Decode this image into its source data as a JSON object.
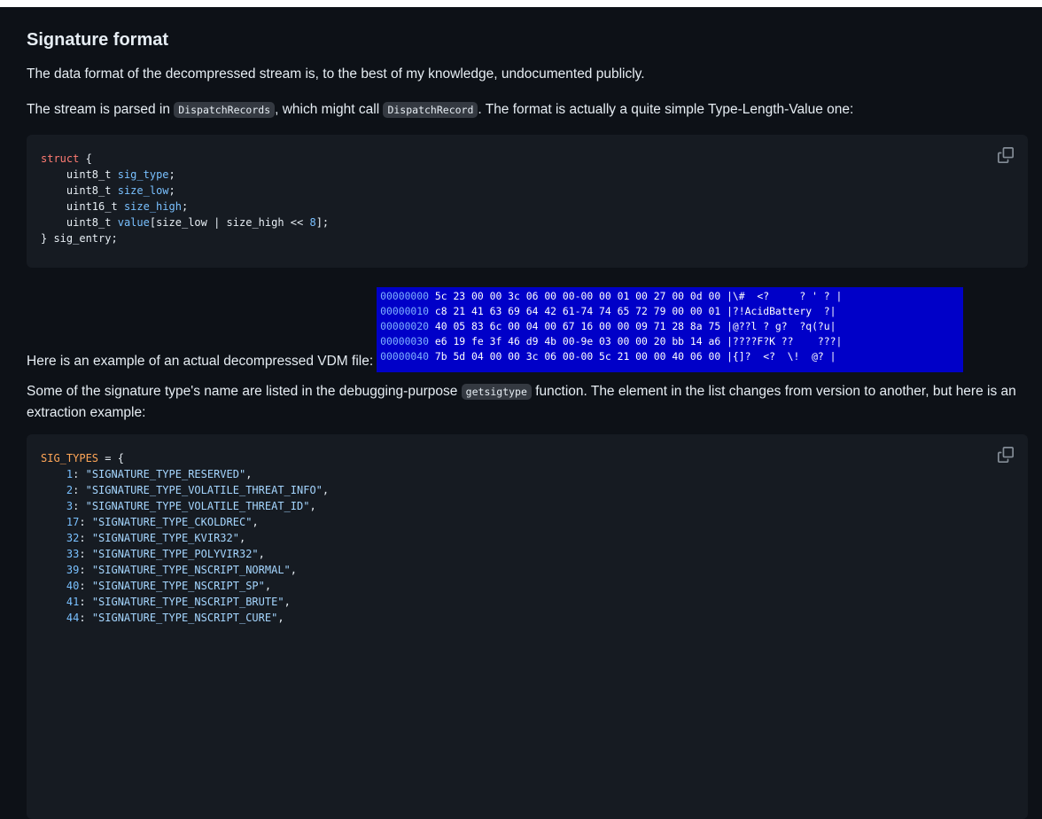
{
  "heading": "Signature format",
  "para1": "The data format of the decompressed stream is, to the best of my knowledge, undocumented publicly.",
  "para2": {
    "pre": "The stream is parsed in ",
    "code1": "DispatchRecords",
    "mid": ", which might call ",
    "code2": "DispatchRecord",
    "post": ". The format is actually a quite simple Type-Length-Value one:"
  },
  "struct_code": {
    "kw_struct": "struct",
    "open": " {",
    "fields": [
      {
        "type": "uint8_t",
        "name": "sig_type",
        "suffix": ";"
      },
      {
        "type": "uint8_t",
        "name": "size_low",
        "suffix": ";"
      },
      {
        "type": "uint16_t",
        "name": "size_high",
        "suffix": ";"
      }
    ],
    "value_line": {
      "type": "uint8_t",
      "name": "value",
      "expr": "[size_low | size_high << ",
      "num": "8",
      "tail": "];"
    },
    "close": "} sig_entry;"
  },
  "example_label": "Here is an example of an actual decompressed VDM file:",
  "hexdump_rows": [
    {
      "addr": "00000000",
      "bytes": "5c 23 00 00 3c 06 00 00-00 00 01 00 27 00 0d 00",
      "ascii": "|\\#  <?     ? ' ? |"
    },
    {
      "addr": "00000010",
      "bytes": "c8 21 41 63 69 64 42 61-74 74 65 72 79 00 00 01",
      "ascii": "|?!AcidBattery  ?|"
    },
    {
      "addr": "00000020",
      "bytes": "40 05 83 6c 00 04 00 67 16 00 00 09 71 28 8a 75",
      "ascii": "|@??l ? g?  ?q(?u|"
    },
    {
      "addr": "00000030",
      "bytes": "e6 19 fe 3f 46 d9 4b 00-9e 03 00 00 20 bb 14 a6",
      "ascii": "|????F?K ??    ???|"
    },
    {
      "addr": "00000040",
      "bytes": "7b 5d 04 00 00 3c 06 00-00 5c 21 00 00 40 06 00",
      "ascii": "|{]?  <?  \\!  @? |"
    }
  ],
  "para3": {
    "pre": "Some of the signature type's name are listed in the debugging-purpose ",
    "code": "getsigtype",
    "post": " function. The element in the list changes from version to another, but here is an extraction example:"
  },
  "sigtypes_code": {
    "head_name": "SIG_TYPES",
    "head_rest": " = {",
    "entries": [
      {
        "num": "1",
        "str": "\"SIGNATURE_TYPE_RESERVED\""
      },
      {
        "num": "2",
        "str": "\"SIGNATURE_TYPE_VOLATILE_THREAT_INFO\""
      },
      {
        "num": "3",
        "str": "\"SIGNATURE_TYPE_VOLATILE_THREAT_ID\""
      },
      {
        "num": "17",
        "str": "\"SIGNATURE_TYPE_CKOLDREC\""
      },
      {
        "num": "32",
        "str": "\"SIGNATURE_TYPE_KVIR32\""
      },
      {
        "num": "33",
        "str": "\"SIGNATURE_TYPE_POLYVIR32\""
      },
      {
        "num": "39",
        "str": "\"SIGNATURE_TYPE_NSCRIPT_NORMAL\""
      },
      {
        "num": "40",
        "str": "\"SIGNATURE_TYPE_NSCRIPT_SP\""
      },
      {
        "num": "41",
        "str": "\"SIGNATURE_TYPE_NSCRIPT_BRUTE\""
      },
      {
        "num": "44",
        "str": "\"SIGNATURE_TYPE_NSCRIPT_CURE\""
      }
    ]
  },
  "icons": {
    "copy": "copy-icon"
  },
  "colors": {
    "background": "#0d1117",
    "code_bg": "#161b22",
    "hex_bg": "#0000c8"
  }
}
